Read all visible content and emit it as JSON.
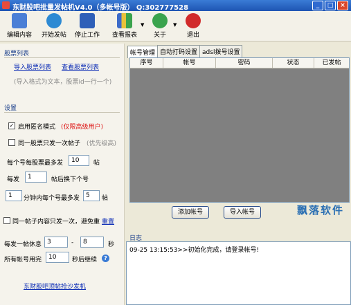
{
  "window": {
    "title": "东财股吧批量发帖机V4.0（多帐号版）  Q:302777528"
  },
  "toolbar": {
    "items": [
      {
        "label": "编辑内容",
        "icon": "edit-icon",
        "color": "#4a7fd6"
      },
      {
        "label": "开始发帖",
        "icon": "play-icon",
        "color": "#2d8ad3"
      },
      {
        "label": "停止工作",
        "icon": "stop-icon",
        "color": "#2e5fb8"
      },
      {
        "label": "查看报表",
        "icon": "chart-icon",
        "color": "#3c6bc9"
      },
      {
        "label": "关于",
        "icon": "globe-icon",
        "color": "#3aa34d"
      },
      {
        "label": "退出",
        "icon": "exit-icon",
        "color": "#d12b2b"
      }
    ]
  },
  "stocks": {
    "title": "股票列表",
    "import_link": "导入股票列表",
    "view_link": "查看股票列表",
    "hint": "(导入格式为文本，股票id一行一个)"
  },
  "settings": {
    "title": "设置",
    "anonymous_label": "启用匿名模式",
    "anonymous_note": "(仅限高级用户)",
    "anonymous_checked": "✓",
    "once_per_stock_label": "同一股票只发一次帖子",
    "once_per_stock_note": "(优先级高)",
    "max_per_stock_label": "每个号每股票最多发",
    "max_per_stock_value": "10",
    "max_per_stock_unit": "帖",
    "switch_prefix": "每发",
    "switch_value": "1",
    "switch_suffix": "帖后换下个号",
    "minutes_value": "1",
    "minutes_label": "分钟内每个号最多发",
    "minutes_max_value": "5",
    "minutes_unit": "帖",
    "dedupe_label": "同一帖子内容只发一次，避免重",
    "dedupe_link": "重置",
    "rest_label": "每发一帖休息",
    "rest_min": "3",
    "rest_sep": "-",
    "rest_max": "8",
    "rest_unit": "秒",
    "all_used_label": "所有帐号用完",
    "all_used_value": "10",
    "all_used_suffix": "秒后继续",
    "bottom_link": "东财股吧顶帖抢沙发机"
  },
  "tabs": [
    "帐号管理",
    "自动打码设置",
    "adsl拨号设置"
  ],
  "account_table": {
    "columns": [
      "序号",
      "帐号",
      "密码",
      "状态",
      "已发帖"
    ]
  },
  "buttons": {
    "add_account": "添加帐号",
    "import_account": "导入帐号"
  },
  "watermark": "飘落软件",
  "log": {
    "title": "日志",
    "entries": [
      "09-25 13:15:53>>初始化完成，请登录帐号!"
    ]
  }
}
